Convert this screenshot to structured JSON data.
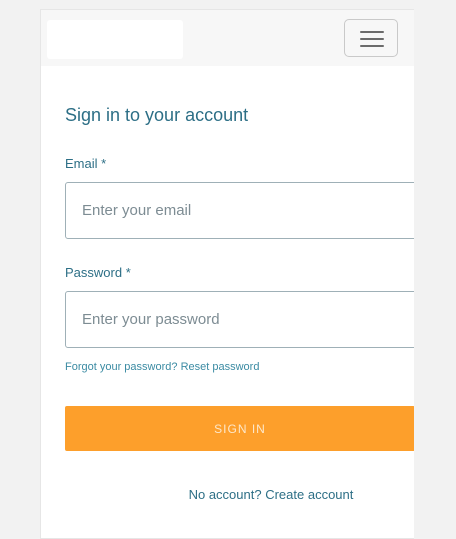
{
  "navbar": {
    "logo_icon": "logo",
    "menu_icon": "hamburger-menu-icon"
  },
  "form": {
    "title": "Sign in to your account",
    "email": {
      "label": "Email",
      "required_marker": "*",
      "placeholder": "Enter your email",
      "value": ""
    },
    "password": {
      "label": "Password",
      "required_marker": "*",
      "placeholder": "Enter your password",
      "value": ""
    },
    "forgot_text": "Forgot your password?",
    "reset_link": "Reset password",
    "submit_label": "SIGN IN",
    "no_account_text": "No account?",
    "create_link": "Create account"
  },
  "colors": {
    "accent": "#fd9f2b",
    "text": "#2d6f86",
    "link": "#3b8ba3"
  }
}
